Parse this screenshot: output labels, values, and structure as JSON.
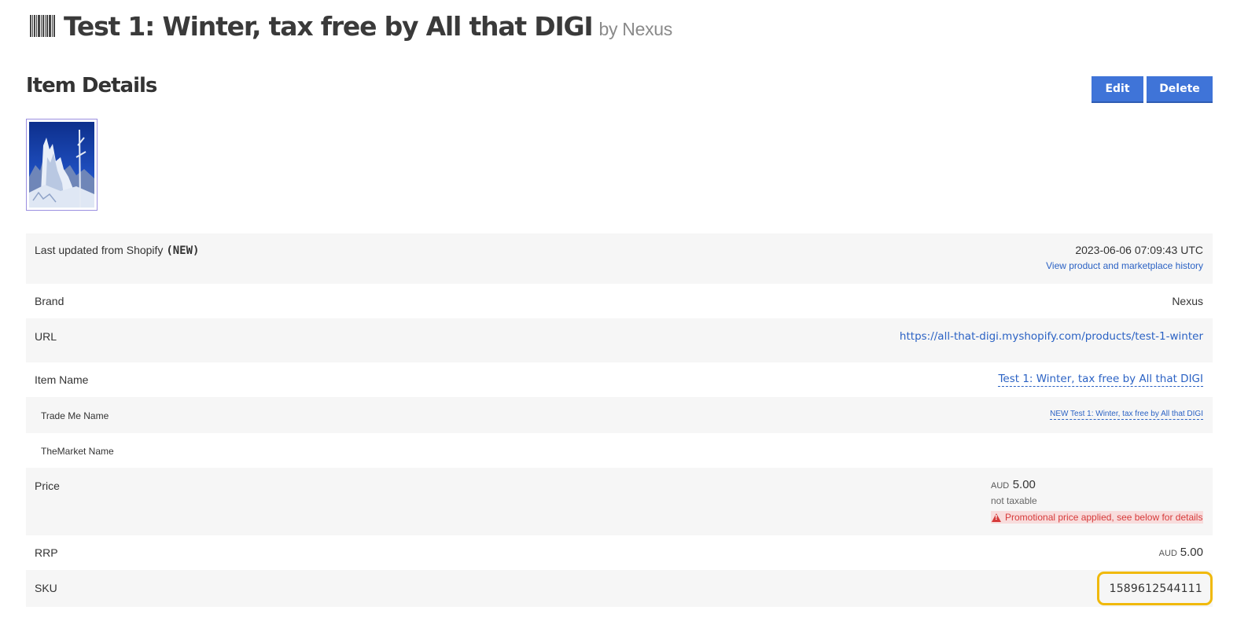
{
  "header": {
    "title": "Test 1: Winter, tax free by All that DIGI",
    "by": "by Nexus"
  },
  "section": {
    "title": "Item Details",
    "edit_label": "Edit",
    "delete_label": "Delete"
  },
  "details": {
    "last_updated": {
      "label": "Last updated from Shopify",
      "tag": "(NEW)",
      "value": "2023-06-06 07:09:43 UTC",
      "history_link": "View product and marketplace history"
    },
    "brand": {
      "label": "Brand",
      "value": "Nexus"
    },
    "url": {
      "label": "URL",
      "value": "https://all-that-digi.myshopify.com/products/test-1-winter"
    },
    "item_name": {
      "label": "Item Name",
      "value": "Test 1: Winter, tax free by All that DIGI"
    },
    "trade_me_name": {
      "label": "Trade Me Name",
      "value": "NEW Test 1: Winter, tax free by All that DIGI"
    },
    "themarket_name": {
      "label": "TheMarket Name",
      "value": ""
    },
    "price": {
      "label": "Price",
      "currency": "AUD",
      "amount": "5.00",
      "tax_note": "not taxable",
      "promo_warning": "Promotional price applied, see below for details"
    },
    "rrp": {
      "label": "RRP",
      "currency": "AUD",
      "amount": "5.00"
    },
    "sku": {
      "label": "SKU",
      "value": "1589612544111"
    }
  },
  "colors": {
    "primary_button": "#3f74d8",
    "link": "#2b62c4",
    "warning": "#d63a3a",
    "highlight": "#f0b90b"
  },
  "icons": {
    "title_icon": "barcode-icon",
    "promo_icon": "warning-triangle-icon"
  }
}
